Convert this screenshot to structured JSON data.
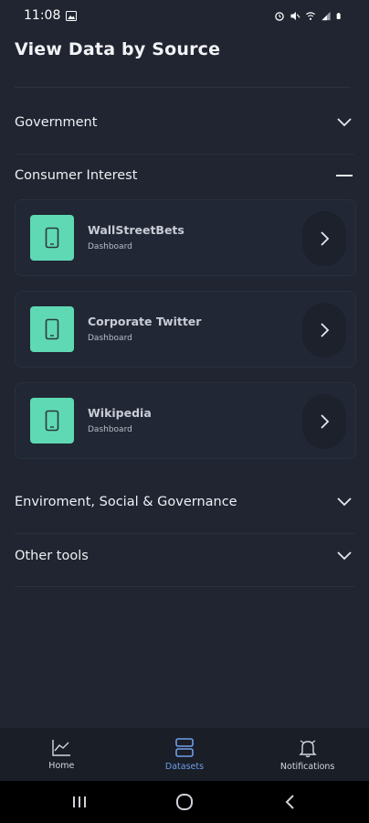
{
  "status_bar": {
    "time": "11:08"
  },
  "page": {
    "title": "View Data by Source"
  },
  "sections": [
    {
      "label": "Government",
      "state": "collapsed"
    },
    {
      "label": "Consumer Interest",
      "state": "expanded"
    },
    {
      "label": "Enviroment, Social & Governance",
      "state": "collapsed"
    },
    {
      "label": "Other tools",
      "state": "collapsed"
    }
  ],
  "cards": [
    {
      "title": "WallStreetBets",
      "subtitle": "Dashboard",
      "icon": "phone-icon"
    },
    {
      "title": "Corporate Twitter",
      "subtitle": "Dashboard",
      "icon": "phone-icon"
    },
    {
      "title": "Wikipedia",
      "subtitle": "Dashboard",
      "icon": "phone-icon"
    }
  ],
  "bottom_nav": {
    "items": [
      {
        "label": "Home",
        "icon": "chart-line-icon",
        "active": false
      },
      {
        "label": "Datasets",
        "icon": "datasets-icon",
        "active": true
      },
      {
        "label": "Notifications",
        "icon": "bell-icon",
        "active": false
      }
    ]
  },
  "colors": {
    "background": "#202531",
    "accent_tile": "#5fd9b4",
    "active_nav": "#6f9ee8"
  }
}
